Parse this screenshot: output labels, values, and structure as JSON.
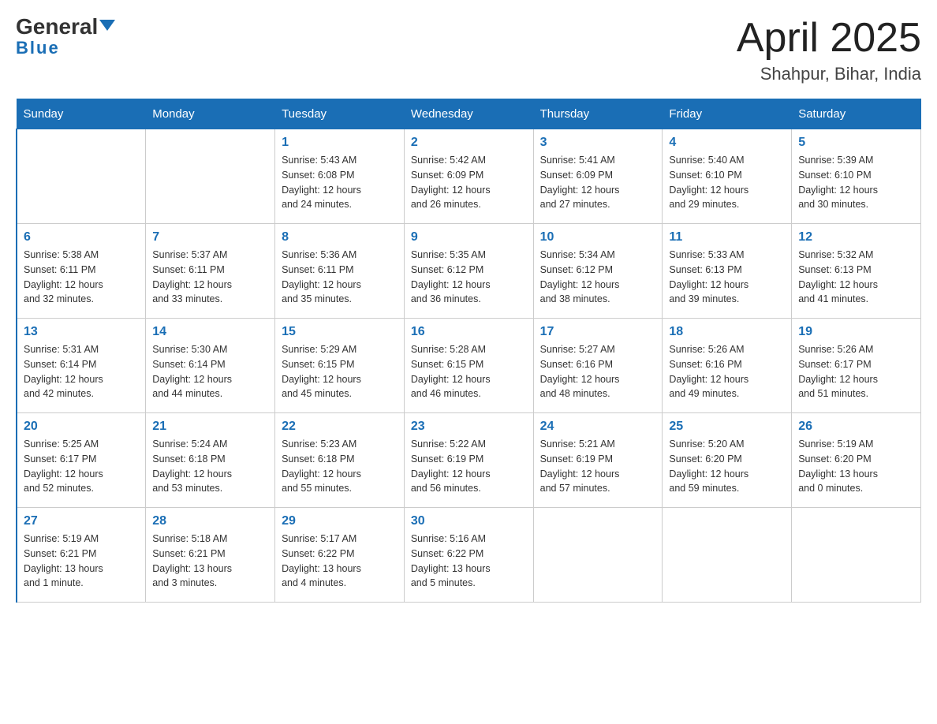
{
  "header": {
    "logo_general": "General",
    "logo_blue": "Blue",
    "month": "April 2025",
    "location": "Shahpur, Bihar, India"
  },
  "weekdays": [
    "Sunday",
    "Monday",
    "Tuesday",
    "Wednesday",
    "Thursday",
    "Friday",
    "Saturday"
  ],
  "weeks": [
    [
      {
        "day": "",
        "info": ""
      },
      {
        "day": "",
        "info": ""
      },
      {
        "day": "1",
        "info": "Sunrise: 5:43 AM\nSunset: 6:08 PM\nDaylight: 12 hours\nand 24 minutes."
      },
      {
        "day": "2",
        "info": "Sunrise: 5:42 AM\nSunset: 6:09 PM\nDaylight: 12 hours\nand 26 minutes."
      },
      {
        "day": "3",
        "info": "Sunrise: 5:41 AM\nSunset: 6:09 PM\nDaylight: 12 hours\nand 27 minutes."
      },
      {
        "day": "4",
        "info": "Sunrise: 5:40 AM\nSunset: 6:10 PM\nDaylight: 12 hours\nand 29 minutes."
      },
      {
        "day": "5",
        "info": "Sunrise: 5:39 AM\nSunset: 6:10 PM\nDaylight: 12 hours\nand 30 minutes."
      }
    ],
    [
      {
        "day": "6",
        "info": "Sunrise: 5:38 AM\nSunset: 6:11 PM\nDaylight: 12 hours\nand 32 minutes."
      },
      {
        "day": "7",
        "info": "Sunrise: 5:37 AM\nSunset: 6:11 PM\nDaylight: 12 hours\nand 33 minutes."
      },
      {
        "day": "8",
        "info": "Sunrise: 5:36 AM\nSunset: 6:11 PM\nDaylight: 12 hours\nand 35 minutes."
      },
      {
        "day": "9",
        "info": "Sunrise: 5:35 AM\nSunset: 6:12 PM\nDaylight: 12 hours\nand 36 minutes."
      },
      {
        "day": "10",
        "info": "Sunrise: 5:34 AM\nSunset: 6:12 PM\nDaylight: 12 hours\nand 38 minutes."
      },
      {
        "day": "11",
        "info": "Sunrise: 5:33 AM\nSunset: 6:13 PM\nDaylight: 12 hours\nand 39 minutes."
      },
      {
        "day": "12",
        "info": "Sunrise: 5:32 AM\nSunset: 6:13 PM\nDaylight: 12 hours\nand 41 minutes."
      }
    ],
    [
      {
        "day": "13",
        "info": "Sunrise: 5:31 AM\nSunset: 6:14 PM\nDaylight: 12 hours\nand 42 minutes."
      },
      {
        "day": "14",
        "info": "Sunrise: 5:30 AM\nSunset: 6:14 PM\nDaylight: 12 hours\nand 44 minutes."
      },
      {
        "day": "15",
        "info": "Sunrise: 5:29 AM\nSunset: 6:15 PM\nDaylight: 12 hours\nand 45 minutes."
      },
      {
        "day": "16",
        "info": "Sunrise: 5:28 AM\nSunset: 6:15 PM\nDaylight: 12 hours\nand 46 minutes."
      },
      {
        "day": "17",
        "info": "Sunrise: 5:27 AM\nSunset: 6:16 PM\nDaylight: 12 hours\nand 48 minutes."
      },
      {
        "day": "18",
        "info": "Sunrise: 5:26 AM\nSunset: 6:16 PM\nDaylight: 12 hours\nand 49 minutes."
      },
      {
        "day": "19",
        "info": "Sunrise: 5:26 AM\nSunset: 6:17 PM\nDaylight: 12 hours\nand 51 minutes."
      }
    ],
    [
      {
        "day": "20",
        "info": "Sunrise: 5:25 AM\nSunset: 6:17 PM\nDaylight: 12 hours\nand 52 minutes."
      },
      {
        "day": "21",
        "info": "Sunrise: 5:24 AM\nSunset: 6:18 PM\nDaylight: 12 hours\nand 53 minutes."
      },
      {
        "day": "22",
        "info": "Sunrise: 5:23 AM\nSunset: 6:18 PM\nDaylight: 12 hours\nand 55 minutes."
      },
      {
        "day": "23",
        "info": "Sunrise: 5:22 AM\nSunset: 6:19 PM\nDaylight: 12 hours\nand 56 minutes."
      },
      {
        "day": "24",
        "info": "Sunrise: 5:21 AM\nSunset: 6:19 PM\nDaylight: 12 hours\nand 57 minutes."
      },
      {
        "day": "25",
        "info": "Sunrise: 5:20 AM\nSunset: 6:20 PM\nDaylight: 12 hours\nand 59 minutes."
      },
      {
        "day": "26",
        "info": "Sunrise: 5:19 AM\nSunset: 6:20 PM\nDaylight: 13 hours\nand 0 minutes."
      }
    ],
    [
      {
        "day": "27",
        "info": "Sunrise: 5:19 AM\nSunset: 6:21 PM\nDaylight: 13 hours\nand 1 minute."
      },
      {
        "day": "28",
        "info": "Sunrise: 5:18 AM\nSunset: 6:21 PM\nDaylight: 13 hours\nand 3 minutes."
      },
      {
        "day": "29",
        "info": "Sunrise: 5:17 AM\nSunset: 6:22 PM\nDaylight: 13 hours\nand 4 minutes."
      },
      {
        "day": "30",
        "info": "Sunrise: 5:16 AM\nSunset: 6:22 PM\nDaylight: 13 hours\nand 5 minutes."
      },
      {
        "day": "",
        "info": ""
      },
      {
        "day": "",
        "info": ""
      },
      {
        "day": "",
        "info": ""
      }
    ]
  ]
}
